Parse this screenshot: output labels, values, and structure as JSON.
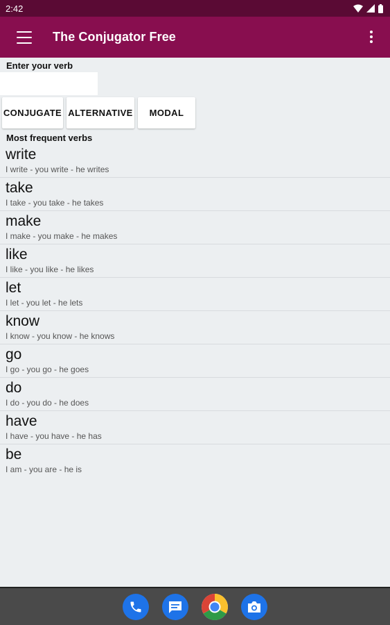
{
  "status_bar": {
    "time": "2:42"
  },
  "app_bar": {
    "title": "The Conjugator Free"
  },
  "input": {
    "label": "Enter your verb",
    "value": "",
    "placeholder": ""
  },
  "buttons": {
    "conjugate": "CONJUGATE",
    "alternative": "ALTERNATIVE",
    "modal": "MODAL"
  },
  "list": {
    "heading": "Most frequent verbs",
    "verbs": [
      {
        "name": "write",
        "forms": "I write - you write - he writes"
      },
      {
        "name": "take",
        "forms": "I take - you take - he takes"
      },
      {
        "name": "make",
        "forms": "I make - you make - he makes"
      },
      {
        "name": "like",
        "forms": "I like - you like - he likes"
      },
      {
        "name": "let",
        "forms": "I let - you let - he lets"
      },
      {
        "name": "know",
        "forms": "I know - you know - he knows"
      },
      {
        "name": "go",
        "forms": "I go - you go - he goes"
      },
      {
        "name": "do",
        "forms": "I do - you do - he does"
      },
      {
        "name": "have",
        "forms": "I have - you have - he has"
      },
      {
        "name": "be",
        "forms": "I am - you are - he is"
      }
    ]
  },
  "dock": [
    "phone-icon",
    "messages-icon",
    "chrome-icon",
    "camera-icon"
  ],
  "colors": {
    "app_bar": "#880e4f",
    "status_bar": "#5a0a34",
    "background": "#eceff1",
    "nav_bar": "#4a4a4a"
  }
}
